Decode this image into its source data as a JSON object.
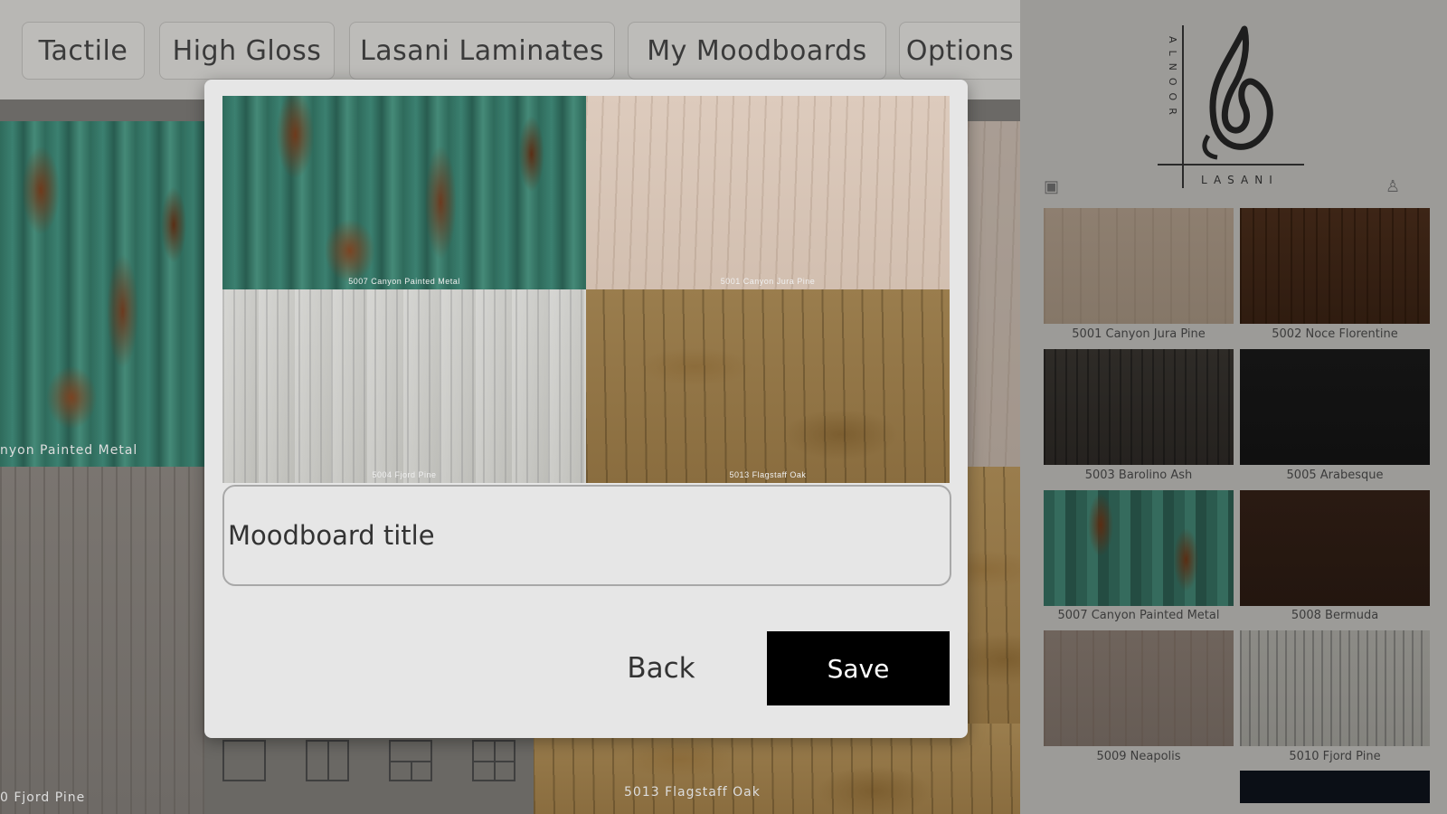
{
  "tabs": [
    {
      "label": "Tactile"
    },
    {
      "label": "High Gloss"
    },
    {
      "label": "Lasani Laminates"
    },
    {
      "label": "My Moodboards"
    },
    {
      "label": "Options"
    }
  ],
  "canvas": {
    "tiles": [
      {
        "label": "nyon Painted Metal",
        "texture": "painted-metal"
      },
      {
        "label": "0 Fjord Pine",
        "texture": "grey-wood"
      },
      {
        "label": "5013 Flagstaff Oak",
        "texture": "oak"
      }
    ],
    "layout_icons": [
      "single-layout-icon",
      "two-column-layout-icon",
      "split-layout-icon",
      "grid-layout-icon"
    ]
  },
  "brand": {
    "vertical_text": "ALNOOR",
    "bottom_text": "LASANI"
  },
  "sidebar": {
    "swatches": [
      {
        "label": "5001 Canyon Jura Pine",
        "texture": "canyon"
      },
      {
        "label": "5002 Noce Florentine",
        "texture": "noce"
      },
      {
        "label": "5003 Barolino Ash",
        "texture": "barolino"
      },
      {
        "label": "5005 Arabesque",
        "texture": "arabesque"
      },
      {
        "label": "5007 Canyon Painted Metal",
        "texture": "metal"
      },
      {
        "label": "5008 Bermuda",
        "texture": "bermuda"
      },
      {
        "label": "5009 Neapolis",
        "texture": "neapolis"
      },
      {
        "label": "5010 Fjord Pine",
        "texture": "fjord"
      }
    ]
  },
  "modal": {
    "tiles": [
      {
        "label": "5007 Canyon Painted Metal",
        "texture": "painted-metal"
      },
      {
        "label": "5001 Canyon Jura Pine",
        "texture": "light-wood"
      },
      {
        "label": "5004 Fjord Pine",
        "texture": "white-wood"
      },
      {
        "label": "5013 Flagstaff Oak",
        "texture": "oak"
      }
    ],
    "title_placeholder": "Moodboard title",
    "title_value": "",
    "back_label": "Back",
    "save_label": "Save"
  },
  "colors": {
    "overlay": "#6b6966",
    "modal_bg": "#e6e6e6",
    "save_bg": "#000000"
  }
}
